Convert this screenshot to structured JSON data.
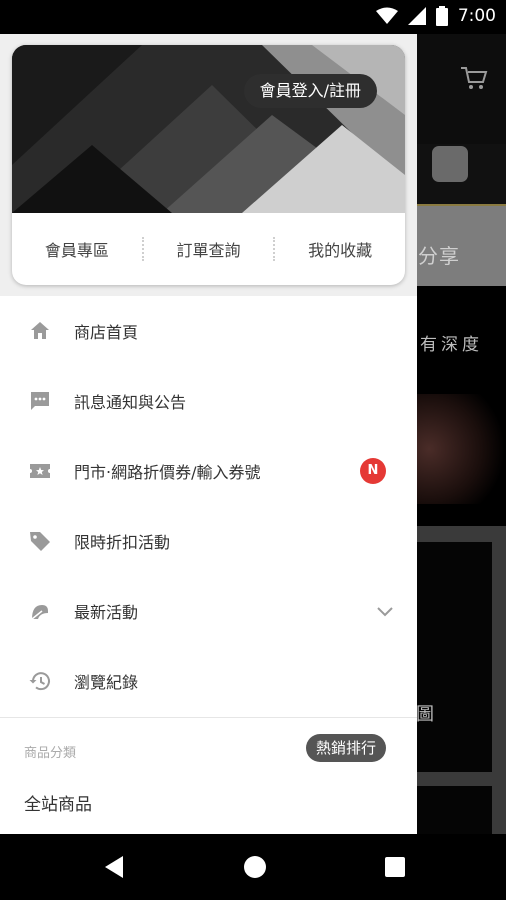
{
  "status": {
    "time": "7:00"
  },
  "background": {
    "share_text": "分享",
    "banner_text": "有深度",
    "card_text": "圖"
  },
  "drawer": {
    "login_button": "會員登入/註冊",
    "quick_links": [
      "會員專區",
      "訂單查詢",
      "我的收藏"
    ],
    "menu": [
      {
        "label": "商店首頁",
        "icon": "home-icon"
      },
      {
        "label": "訊息通知與公告",
        "icon": "message-icon"
      },
      {
        "label": "門市‧網路折價券/輸入券號",
        "icon": "ticket-icon",
        "badge": "N"
      },
      {
        "label": "限時折扣活動",
        "icon": "tag-icon"
      },
      {
        "label": "最新活動",
        "icon": "megaphone-icon",
        "expandable": true
      },
      {
        "label": "瀏覽紀錄",
        "icon": "history-icon"
      }
    ],
    "section_label": "商品分類",
    "hot_tag": "熱銷排行",
    "all_products": "全站商品"
  },
  "colors": {
    "badge": "#e53935",
    "pill": "#2e2e2e"
  }
}
